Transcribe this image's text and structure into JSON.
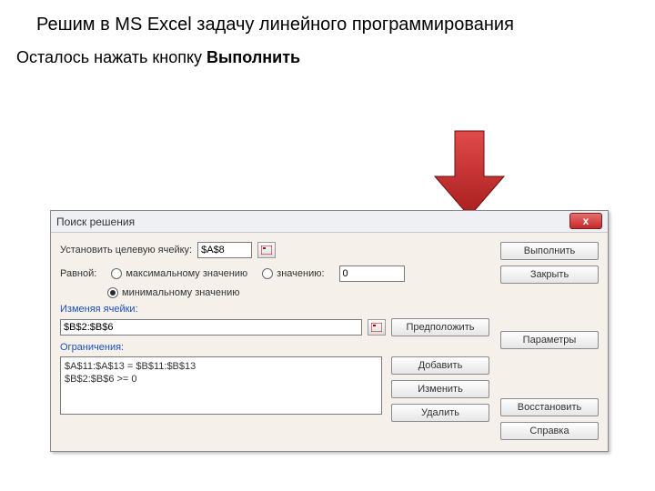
{
  "slide": {
    "title": "Решим в MS Excel задачу линейного программирования",
    "subtitle_pre": "Осталось нажать кнопку ",
    "subtitle_bold": "Выполнить"
  },
  "titlebar": {
    "text": "Поиск решения",
    "close_glyph": "x"
  },
  "target": {
    "label": "Установить целевую ячейку:",
    "cell": "$A$8"
  },
  "equal": {
    "label": "Равной:",
    "opt_max": "максимальному значению",
    "opt_value": "значению:",
    "value": "0",
    "opt_min": "минимальному значению"
  },
  "changing": {
    "section": "Изменяя ячейки:",
    "value": "$B$2:$B$6",
    "suggest": "Предположить"
  },
  "constraints": {
    "section": "Ограничения:",
    "lines": [
      "$A$11:$A$13 = $B$11:$B$13",
      "$B$2:$B$6 >= 0"
    ],
    "add": "Добавить",
    "edit": "Изменить",
    "delete": "Удалить"
  },
  "buttons": {
    "run": "Выполнить",
    "close": "Закрыть",
    "options": "Параметры",
    "reset": "Восстановить",
    "help": "Справка"
  }
}
